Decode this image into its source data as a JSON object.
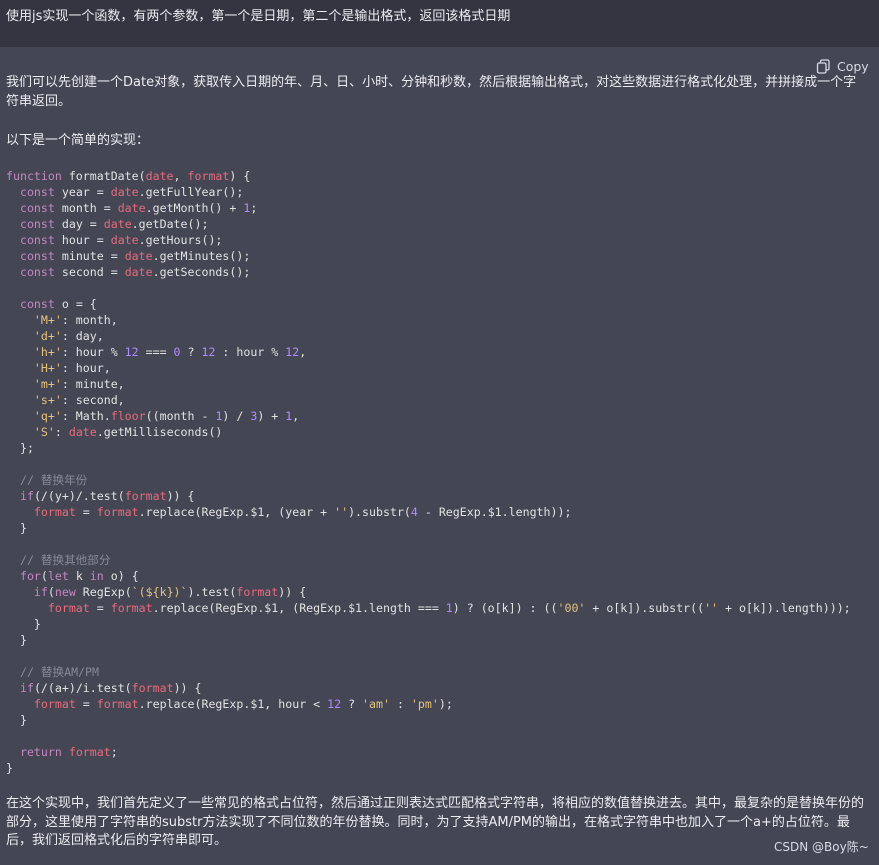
{
  "user_prompt": "使用js实现一个函数，有两个参数，第一个是日期，第二个是输出格式，返回该格式日期",
  "copy_label": "Copy",
  "answer": {
    "intro": "我们可以先创建一个Date对象，获取传入日期的年、月、日、小时、分钟和秒数，然后根据输出格式，对这些数据进行格式化处理，并拼接成一个字符串返回。",
    "lead": "以下是一个简单的实现：",
    "code_lines": [
      "function formatDate(date, format) {",
      "  const year = date.getFullYear();",
      "  const month = date.getMonth() + 1;",
      "  const day = date.getDate();",
      "  const hour = date.getHours();",
      "  const minute = date.getMinutes();",
      "  const second = date.getSeconds();",
      "",
      "  const o = {",
      "    'M+': month,",
      "    'd+': day,",
      "    'h+': hour % 12 === 0 ? 12 : hour % 12,",
      "    'H+': hour,",
      "    'm+': minute,",
      "    's+': second,",
      "    'q+': Math.floor((month - 1) / 3) + 1,",
      "    'S': date.getMilliseconds()",
      "  };",
      "",
      "  // 替换年份",
      "  if(/(y+)/.test(format)) {",
      "    format = format.replace(RegExp.$1, (year + '').substr(4 - RegExp.$1.length));",
      "  }",
      "",
      "  // 替换其他部分",
      "  for(let k in o) {",
      "    if(new RegExp(`(${k})`).test(format)) {",
      "      format = format.replace(RegExp.$1, (RegExp.$1.length === 1) ? (o[k]) : (('00' + o[k]).substr(('' + o[k]).length)));",
      "    }",
      "  }",
      "",
      "  // 替换AM/PM",
      "  if(/(a+)/i.test(format)) {",
      "    format = format.replace(RegExp.$1, hour < 12 ? 'am' : 'pm');",
      "  }",
      "",
      "  return format;",
      "}"
    ],
    "conclusion": "在这个实现中，我们首先定义了一些常见的格式占位符，然后通过正则表达式匹配格式字符串，将相应的数值替换进去。其中，最复杂的是替换年份的部分，这里使用了字符串的substr方法实现了不同位数的年份替换。同时，为了支持AM/PM的输出，在格式字符串中也加入了一个a+的占位符。最后，我们返回格式化后的字符串即可。"
  },
  "watermark": "CSDN @Boy陈~",
  "colors": {
    "user_bg": "#343541",
    "answer_bg": "#444654",
    "keyword": "#c586c0",
    "param": "#e86b7a",
    "string": "#e6c27c",
    "number": "#b08bff",
    "comment": "#858897"
  }
}
